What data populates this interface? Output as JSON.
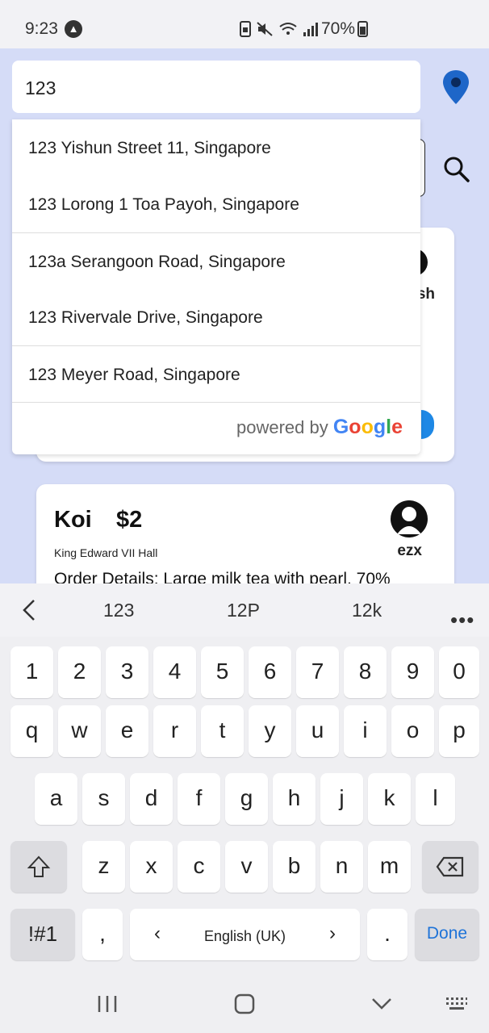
{
  "status_bar": {
    "time": "9:23",
    "battery": "70%"
  },
  "search": {
    "query": "123"
  },
  "suggestions": [
    "123 Yishun Street 11, Singapore",
    "123 Lorong 1 Toa Payoh, Singapore",
    "123a Serangoon Road, Singapore",
    "123 Rivervale Drive, Singapore",
    "123 Meyer Road, Singapore"
  ],
  "attribution": {
    "prefix": "powered by",
    "brand": "Google"
  },
  "card1": {
    "name_fragment": "sh"
  },
  "card2": {
    "title": "Koi",
    "price": "$2",
    "location": "King Edward VII Hall",
    "details": "Order Details:  Large milk tea with pearl, 70%",
    "name": "ezx"
  },
  "keyboard": {
    "suggestions": [
      "123",
      "12P",
      "12k"
    ],
    "more": "•••",
    "number_row": [
      "1",
      "2",
      "3",
      "4",
      "5",
      "6",
      "7",
      "8",
      "9",
      "0"
    ],
    "row1": [
      "q",
      "w",
      "e",
      "r",
      "t",
      "y",
      "u",
      "i",
      "o",
      "p"
    ],
    "row2": [
      "a",
      "s",
      "d",
      "f",
      "g",
      "h",
      "j",
      "k",
      "l"
    ],
    "row3": [
      "z",
      "x",
      "c",
      "v",
      "b",
      "n",
      "m"
    ],
    "symbols": "!#1",
    "comma": ",",
    "language": "English (UK)",
    "period": ".",
    "done": "Done",
    "nav_left": "‹",
    "nav_right": "›"
  },
  "icons": {
    "location": "map-pin-icon",
    "search": "search-icon",
    "shift": "shift-icon",
    "backspace": "backspace-icon",
    "recents": "recent-apps-icon",
    "home": "home-icon",
    "back": "chevron-down-icon",
    "keyboard": "keyboard-icon"
  },
  "colors": {
    "background": "#d5dcf7",
    "accent": "#1e73d8",
    "pin": "#1e66c8"
  }
}
